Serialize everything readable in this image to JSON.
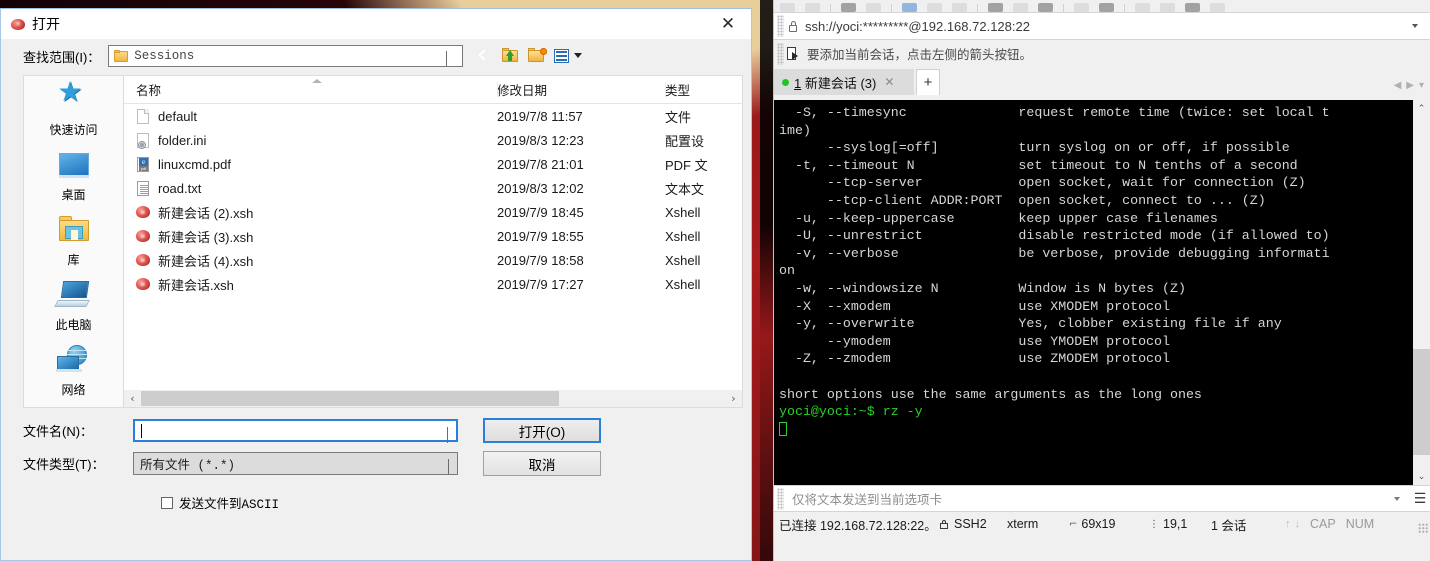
{
  "dialog": {
    "title": "打开",
    "close_label": "✕",
    "lookin": {
      "label": "查找范围(I)：",
      "value": "Sessions"
    },
    "nav": {
      "back": "back-button",
      "up": "up-one-level-button",
      "new_folder": "new-folder-button",
      "view": "view-mode-button"
    },
    "places": [
      {
        "label": "快速访问",
        "icon": "star-icon"
      },
      {
        "label": "桌面",
        "icon": "desktop-monitor-icon"
      },
      {
        "label": "库",
        "icon": "library-folder-icon"
      },
      {
        "label": "此电脑",
        "icon": "this-pc-icon"
      },
      {
        "label": "网络",
        "icon": "network-globe-icon"
      }
    ],
    "columns": [
      "名称",
      "修改日期",
      "类型"
    ],
    "files": [
      {
        "name": "default",
        "date": "2019/7/8 11:57",
        "type": "文件",
        "icon": "blank-document-icon"
      },
      {
        "name": "folder.ini",
        "date": "2019/8/3 12:23",
        "type": "配置设",
        "icon": "config-settings-icon"
      },
      {
        "name": "linuxcmd.pdf",
        "date": "2019/7/8 21:01",
        "type": "PDF 文",
        "icon": "pdf-document-icon"
      },
      {
        "name": "road.txt",
        "date": "2019/8/3 12:02",
        "type": "文本文",
        "icon": "text-document-icon"
      },
      {
        "name": "新建会话 (2).xsh",
        "date": "2019/7/9 18:45",
        "type": "Xshell",
        "icon": "xshell-session-icon"
      },
      {
        "name": "新建会话 (3).xsh",
        "date": "2019/7/9 18:55",
        "type": "Xshell",
        "icon": "xshell-session-icon"
      },
      {
        "name": "新建会话 (4).xsh",
        "date": "2019/7/9 18:58",
        "type": "Xshell",
        "icon": "xshell-session-icon"
      },
      {
        "name": "新建会话.xsh",
        "date": "2019/7/9 17:27",
        "type": "Xshell",
        "icon": "xshell-session-icon"
      }
    ],
    "scroll_left": "‹",
    "scroll_right": "›",
    "form": {
      "filename_label": "文件名(N)：",
      "filename_value": "",
      "filetype_label": "文件类型(T)：",
      "filetype_value": "所有文件 (*.*)",
      "open_button": "打开(O)",
      "cancel_button": "取消",
      "ascii_checkbox_label": "发送文件到ASCII",
      "ascii_checked": false
    }
  },
  "xshell": {
    "address": "ssh://yoci:*********@192.168.72.128:22",
    "hint": "要添加当前会话，点击左侧的箭头按钮。",
    "tab": {
      "index": "1",
      "label": " 新建会话 (3)",
      "close": "✕",
      "new_tab": "+"
    },
    "terminal": {
      "lines": [
        "  -S, --timesync              request remote time (twice: set local t",
        "ime)",
        "      --syslog[=off]          turn syslog on or off, if possible",
        "  -t, --timeout N             set timeout to N tenths of a second",
        "      --tcp-server            open socket, wait for connection (Z)",
        "      --tcp-client ADDR:PORT  open socket, connect to ... (Z)",
        "  -u, --keep-uppercase        keep upper case filenames",
        "  -U, --unrestrict            disable restricted mode (if allowed to)",
        "  -v, --verbose               be verbose, provide debugging informati",
        "on",
        "  -w, --windowsize N          Window is N bytes (Z)",
        "  -X  --xmodem                use XMODEM protocol",
        "  -y, --overwrite             Yes, clobber existing file if any",
        "      --ymodem                use YMODEM protocol",
        "  -Z, --zmodem                use ZMODEM protocol",
        "",
        "short options use the same arguments as the long ones",
        "yoci@yoci:~$ rz -y"
      ]
    },
    "sendbar": {
      "placeholder": "仅将文本发送到当前选项卡",
      "menu_icon": "☰"
    },
    "status": {
      "connection": "已连接 192.168.72.128:22。",
      "protocol": "SSH2",
      "term_type": "xterm",
      "size": "69x19",
      "cursor": "19,1",
      "sessions": "1 会话",
      "cap": "CAP",
      "num": "NUM"
    }
  }
}
